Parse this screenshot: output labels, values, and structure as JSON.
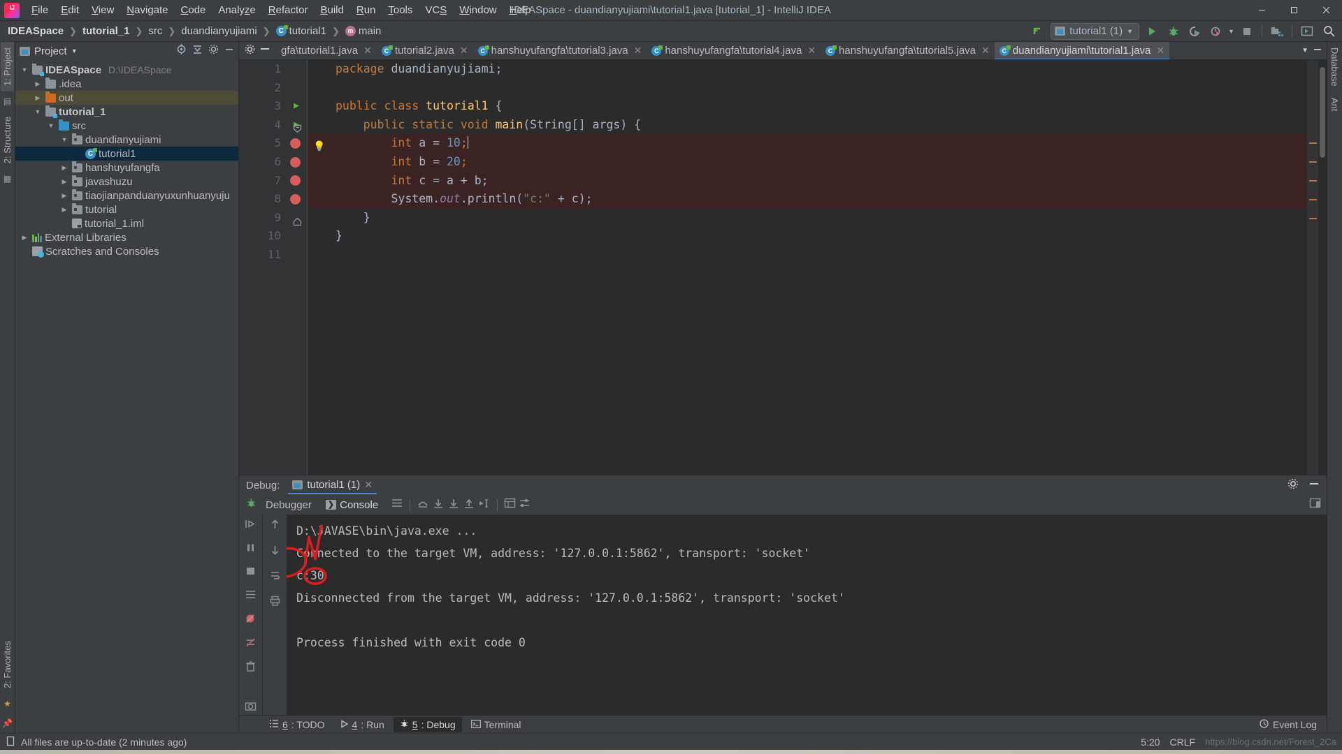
{
  "window": {
    "title": "IDEASpace - duandianyujiami\\tutorial1.java [tutorial_1] - IntelliJ IDEA",
    "minimize": "–",
    "maximize": "☐",
    "close": "✕"
  },
  "menubar": [
    {
      "label": "File"
    },
    {
      "label": "Edit"
    },
    {
      "label": "View"
    },
    {
      "label": "Navigate"
    },
    {
      "label": "Code"
    },
    {
      "label": "Analyze"
    },
    {
      "label": "Refactor"
    },
    {
      "label": "Build"
    },
    {
      "label": "Run"
    },
    {
      "label": "Tools"
    },
    {
      "label": "VCS"
    },
    {
      "label": "Window"
    },
    {
      "label": "Help"
    }
  ],
  "breadcrumbs": [
    {
      "label": "IDEASpace",
      "bold": true
    },
    {
      "label": "tutorial_1",
      "bold": true
    },
    {
      "label": "src",
      "bold": false
    },
    {
      "label": "duandianyujiami",
      "bold": false
    },
    {
      "label": "tutorial1",
      "bold": false
    },
    {
      "label": "main",
      "bold": false
    }
  ],
  "toolbar": {
    "run_config": "tutorial1 (1)",
    "run_title": "Run",
    "debug_title": "Debug",
    "run_coverage_title": "Run with Coverage",
    "profile_title": "Profiler",
    "stop_title": "Stop",
    "build_title": "Build Project",
    "updates_title": "Updates",
    "search_title": "Search Everywhere"
  },
  "left_rail": [
    {
      "label": "1: Project",
      "active": true
    },
    {
      "label": "2: Structure",
      "active": false
    },
    {
      "label": "2: Favorites",
      "active": false
    }
  ],
  "right_rail": [
    {
      "label": "Database"
    },
    {
      "label": "Ant"
    }
  ],
  "project": {
    "panel_title": "Project",
    "tree": [
      {
        "indent": 0,
        "twist": "▼",
        "icon": "folder-module",
        "label": "IDEASpace",
        "bold": true,
        "sub": "D:\\IDEASpace",
        "state": "none"
      },
      {
        "indent": 1,
        "twist": "▶",
        "icon": "folder",
        "label": ".idea",
        "bold": false,
        "sub": "",
        "state": "none"
      },
      {
        "indent": 1,
        "twist": "▶",
        "icon": "folder-orange",
        "label": "out",
        "bold": false,
        "sub": "",
        "state": "hl"
      },
      {
        "indent": 1,
        "twist": "▼",
        "icon": "folder-module",
        "label": "tutorial_1",
        "bold": true,
        "sub": "",
        "state": "none"
      },
      {
        "indent": 2,
        "twist": "▼",
        "icon": "folder-blue",
        "label": "src",
        "bold": false,
        "sub": "",
        "state": "none"
      },
      {
        "indent": 3,
        "twist": "▼",
        "icon": "folder-pkg",
        "label": "duandianyujiami",
        "bold": false,
        "sub": "",
        "state": "none"
      },
      {
        "indent": 4,
        "twist": "",
        "icon": "class",
        "label": "tutorial1",
        "bold": false,
        "sub": "",
        "state": "sel"
      },
      {
        "indent": 3,
        "twist": "▶",
        "icon": "folder-pkg",
        "label": "hanshuyufangfa",
        "bold": false,
        "sub": "",
        "state": "none"
      },
      {
        "indent": 3,
        "twist": "▶",
        "icon": "folder-pkg",
        "label": "javashuzu",
        "bold": false,
        "sub": "",
        "state": "none"
      },
      {
        "indent": 3,
        "twist": "▶",
        "icon": "folder-pkg",
        "label": "tiaojianpanduanyuxunhuanyuju",
        "bold": false,
        "sub": "",
        "state": "none"
      },
      {
        "indent": 3,
        "twist": "▶",
        "icon": "folder-pkg",
        "label": "tutorial",
        "bold": false,
        "sub": "",
        "state": "none"
      },
      {
        "indent": 3,
        "twist": "",
        "icon": "iml",
        "label": "tutorial_1.iml",
        "bold": false,
        "sub": "",
        "state": "none"
      },
      {
        "indent": 0,
        "twist": "▶",
        "icon": "library",
        "label": "External Libraries",
        "bold": false,
        "sub": "",
        "state": "none"
      },
      {
        "indent": 0,
        "twist": "",
        "icon": "scratch",
        "label": "Scratches and Consoles",
        "bold": false,
        "sub": "",
        "state": "none"
      }
    ]
  },
  "editor": {
    "tabs": [
      {
        "label": "gfa\\tutorial1.java",
        "active": false,
        "icon": false
      },
      {
        "label": "tutorial2.java",
        "active": false,
        "icon": true
      },
      {
        "label": "hanshuyufangfa\\tutorial3.java",
        "active": false,
        "icon": true
      },
      {
        "label": "hanshuyufangfa\\tutorial4.java",
        "active": false,
        "icon": true
      },
      {
        "label": "hanshuyufangfa\\tutorial5.java",
        "active": false,
        "icon": true
      },
      {
        "label": "duandianyujiami\\tutorial1.java",
        "active": true,
        "icon": true
      }
    ],
    "lines": [
      {
        "n": "1",
        "gutter": "",
        "highlight": false
      },
      {
        "n": "2",
        "gutter": "",
        "highlight": false
      },
      {
        "n": "3",
        "gutter": "run",
        "highlight": false
      },
      {
        "n": "4",
        "gutter": "run",
        "highlight": false
      },
      {
        "n": "5",
        "gutter": "breakpoint",
        "highlight": true
      },
      {
        "n": "6",
        "gutter": "breakpoint",
        "highlight": true
      },
      {
        "n": "7",
        "gutter": "breakpoint",
        "highlight": true
      },
      {
        "n": "8",
        "gutter": "breakpoint",
        "highlight": true
      },
      {
        "n": "9",
        "gutter": "",
        "highlight": false
      },
      {
        "n": "10",
        "gutter": "",
        "highlight": false
      },
      {
        "n": "11",
        "gutter": "",
        "highlight": false
      }
    ],
    "code": {
      "l1_kw": "package",
      "l1_name": " duandianyujiami;",
      "l3_kw1": "public",
      "l3_kw2": "class",
      "l3_name": "tutorial1",
      "l3_brace": "{",
      "l4_kw1": "public",
      "l4_kw2": "static",
      "l4_kw3": "void",
      "l4_name": "main",
      "l4_args": "(String[] args) {",
      "l5_kw": "int",
      "l5_rest": " a = ",
      "l5_num": "10",
      "l5_semi": ";",
      "l6_kw": "int",
      "l6_rest": " b = ",
      "l6_num": "20",
      "l6_semi": ";",
      "l7_kw": "int",
      "l7_rest": " c = a + b;",
      "l8_a": "System.",
      "l8_out": "out",
      "l8_b": ".println(",
      "l8_str": "\"c:\"",
      "l8_c": " + c);",
      "l9": "}",
      "l10": "}"
    }
  },
  "debug": {
    "label": "Debug:",
    "session_tab": "tutorial1 (1)",
    "tabs": [
      {
        "label": "Debugger",
        "selected": false
      },
      {
        "label": "Console",
        "selected": true
      }
    ],
    "console_lines": [
      {
        "text": "D:\\JAVASE\\bin\\java.exe ...",
        "dim": true
      },
      {
        "text": "Connected to the target VM, address: '127.0.0.1:5862', transport: 'socket'",
        "dim": false
      },
      {
        "text": "c:30",
        "dim": false
      },
      {
        "text": "Disconnected from the target VM, address: '127.0.0.1:5862', transport: 'socket'",
        "dim": false
      },
      {
        "text": "",
        "dim": false
      },
      {
        "text": "Process finished with exit code 0",
        "dim": false
      }
    ]
  },
  "bottom_tabs": [
    {
      "num": "6",
      "label": ": TODO",
      "icon": "todo-icon",
      "selected": false
    },
    {
      "num": "4",
      "label": ": Run",
      "icon": "run-icon",
      "selected": false
    },
    {
      "num": "5",
      "label": ": Debug",
      "icon": "debug-icon",
      "selected": true
    },
    {
      "num": "",
      "label": "Terminal",
      "icon": "terminal-icon",
      "selected": false
    }
  ],
  "event_log": "Event Log",
  "status": {
    "message": "All files are up-to-date (2 minutes ago)",
    "caret": "5:20",
    "line_sep": "CRLF",
    "watermark": "https://blog.csdn.net/Forest_2Ca"
  },
  "colors": {
    "accent": "#4a88c7",
    "keyword": "#cc7832",
    "string": "#6a8759",
    "number": "#6897bb",
    "breakpoint": "#db5c5c",
    "annotation": "#e01b1b"
  }
}
